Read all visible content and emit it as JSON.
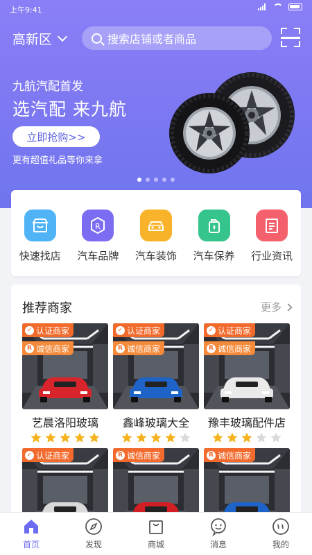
{
  "status": {
    "time": "上午9:41"
  },
  "header": {
    "location": "高新区",
    "search_placeholder": "搜索店铺或者商品"
  },
  "banner": {
    "subtitle": "九航汽配首发",
    "title": "选汽配 来九航",
    "cta": "立即抢购>>",
    "note": "更有超值礼品等你来拿",
    "slides": 5,
    "active_slide": 1
  },
  "categories": [
    {
      "label": "快速找店",
      "icon": "store-icon",
      "color": "#4fb3f6"
    },
    {
      "label": "汽车品牌",
      "icon": "brand-r-icon",
      "color": "#7c6cf2"
    },
    {
      "label": "汽车装饰",
      "icon": "car-icon",
      "color": "#f8b32a"
    },
    {
      "label": "汽车保养",
      "icon": "oil-can-icon",
      "color": "#35c48c"
    },
    {
      "label": "行业资讯",
      "icon": "news-icon",
      "color": "#f4606c"
    }
  ],
  "merchants": {
    "title": "推荐商家",
    "more": "更多",
    "items": [
      {
        "name": "艺晨洛阳玻璃",
        "rating": 5,
        "badges": [
          "认证商家",
          "诚信商家"
        ],
        "car_color": "#d8242b"
      },
      {
        "name": "鑫峰玻璃大全",
        "rating": 4,
        "badges": [
          "认证商家",
          "诚信商家"
        ],
        "car_color": "#1e63c8"
      },
      {
        "name": "豫丰玻璃配件店",
        "rating": 3,
        "badges": [
          "认证商家",
          "诚信商家"
        ],
        "car_color": "#e9e9e9"
      },
      {
        "name": "",
        "rating": 0,
        "badges": [
          "认证商家"
        ],
        "car_color": "#d9d9d9"
      },
      {
        "name": "",
        "rating": 0,
        "badges": [
          "诚信商家"
        ],
        "car_color": "#d21f26"
      },
      {
        "name": "",
        "rating": 0,
        "badges": [
          "诚信商家"
        ],
        "car_color": "#1e63c8"
      }
    ]
  },
  "tabs": [
    {
      "label": "首页",
      "icon": "home-icon",
      "active": true
    },
    {
      "label": "发现",
      "icon": "compass-icon",
      "active": false
    },
    {
      "label": "商城",
      "icon": "shopping-bag-icon",
      "active": false
    },
    {
      "label": "消息",
      "icon": "message-icon",
      "active": false
    },
    {
      "label": "我的",
      "icon": "profile-icon",
      "active": false
    }
  ],
  "colors": {
    "accent": "#6c6cf0",
    "star": "#f6b21c",
    "star_off": "#d9d9d9",
    "badge": "#f26b2c"
  }
}
